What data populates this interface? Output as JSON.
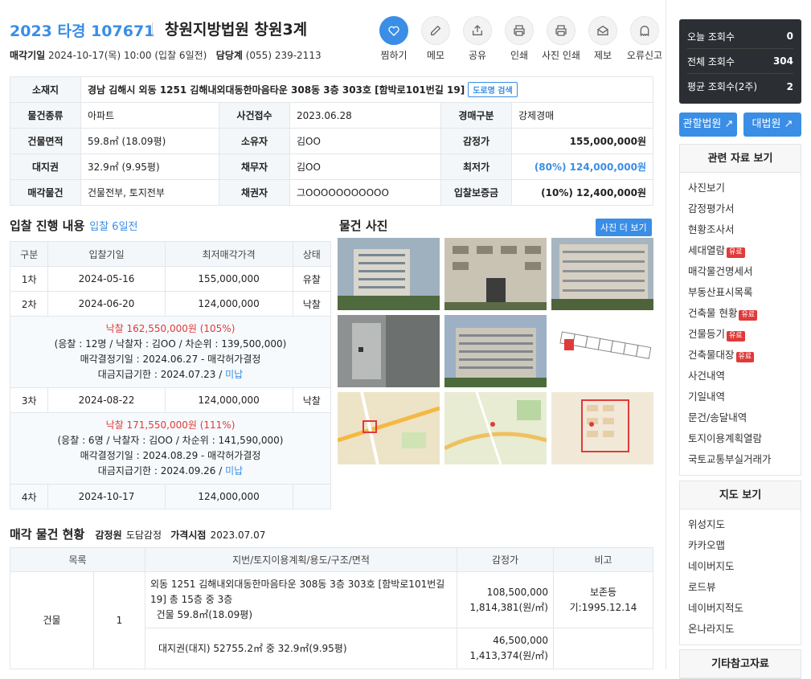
{
  "header": {
    "case_no": "2023 타경 107671",
    "court": "창원지방법원 창원3계",
    "date_label": "매각기일",
    "date_value": "2024-10-17(목) 10:00 (입찰 6일전)",
    "dept_label": "담당계",
    "dept_value": "(055) 239-2113"
  },
  "actions": [
    {
      "label": "찜하기",
      "icon": "heart-icon"
    },
    {
      "label": "메모",
      "icon": "pencil-icon"
    },
    {
      "label": "공유",
      "icon": "share-icon"
    },
    {
      "label": "인쇄",
      "icon": "printer-icon"
    },
    {
      "label": "사진 인쇄",
      "icon": "printer-icon"
    },
    {
      "label": "제보",
      "icon": "envelope-icon"
    },
    {
      "label": "오류신고",
      "icon": "ghost-icon"
    }
  ],
  "info": {
    "addr_label": "소재지",
    "addr": "경남 김해시 외동 1251 김해내외대동한마음타운 308동 3층 303호 [함박로101번길 19]",
    "road_btn": "도로명 검색",
    "type_label": "물건종류",
    "type": "아파트",
    "filed_label": "사건접수",
    "filed": "2023.06.28",
    "kind_label": "경매구분",
    "kind": "강제경매",
    "area_label": "건물면적",
    "area": "59.8㎡ (18.09평)",
    "owner_label": "소유자",
    "owner": "김OO",
    "appr_label": "감정가",
    "appr": "155,000,000원",
    "land_label": "대지권",
    "land": "32.9㎡ (9.95평)",
    "debtor_label": "채무자",
    "debtor": "김OO",
    "min_label": "최저가",
    "min": "(80%) 124,000,000원",
    "sale_label": "매각물건",
    "sale": "건물전부, 토지전부",
    "creditor_label": "채권자",
    "creditor": "그OOOOOOOOOOO",
    "dep_label": "입찰보증금",
    "dep": "(10%) 12,400,000원"
  },
  "bid": {
    "title": "입찰 진행 내용",
    "sub": "입찰 6일전",
    "headers": [
      "구분",
      "입찰기일",
      "최저매각가격",
      "상태"
    ],
    "r1": [
      "1차",
      "2024-05-16",
      "155,000,000",
      "유찰"
    ],
    "r2": [
      "2차",
      "2024-06-20",
      "124,000,000",
      "낙찰"
    ],
    "d2a": "낙찰 162,550,000원",
    "d2b": "(105%)",
    "d2c": "(응찰 : 12명 / 낙찰자 : 김OO / 차순위 : 139,500,000)",
    "d2d": "매각결정기일 : 2024.06.27 - 매각허가결정",
    "d2e": "대금지급기한 : 2024.07.23 /",
    "d2f": "미납",
    "r3": [
      "3차",
      "2024-08-22",
      "124,000,000",
      "낙찰"
    ],
    "d3a": "낙찰 171,550,000원",
    "d3b": "(111%)",
    "d3c": "(응찰 : 6명 / 낙찰자 : 김OO / 차순위 : 141,590,000)",
    "d3d": "매각결정기일 : 2024.08.29 - 매각허가결정",
    "d3e": "대금지급기한 : 2024.09.26 /",
    "d3f": "미납",
    "r4": [
      "4차",
      "2024-10-17",
      "124,000,000",
      ""
    ]
  },
  "photos": {
    "title": "물건 사진",
    "more": "사진 더 보기"
  },
  "sale": {
    "title": "매각 물건 현황",
    "appr_org_label": "감정원",
    "appr_org": "도담감정",
    "price_date_label": "가격시점",
    "price_date": "2023.07.07",
    "headers": [
      "목록",
      "지번/토지이용계획/용도/구조/면적",
      "감정가",
      "비고"
    ],
    "cat": "건물",
    "no": "1",
    "desc1": "외동 1251 김해내외대동한마음타운 308동 3층 303호 [함박로101번길 19] 총 15층 중 3층",
    "desc1b": "건물 59.8㎡(18.09평)",
    "val1": "108,500,000",
    "unit1": "1,814,381(원/㎡)",
    "note1": "보존등기:1995.12.14",
    "desc2": "대지권(대지) 52755.2㎡ 중 32.9㎡(9.95평)",
    "val2": "46,500,000",
    "unit2": "1,413,374(원/㎡)"
  },
  "stats": {
    "today_label": "오늘 조회수",
    "today": "0",
    "total_label": "전체 조회수",
    "total": "304",
    "avg_label": "평균 조회수(2주)",
    "avg": "2"
  },
  "side_btns": {
    "court": "관할법원",
    "supreme": "대법원"
  },
  "related": {
    "title": "관련 자료 보기",
    "items": [
      "사진보기",
      "감정평가서",
      "현황조사서",
      "세대열람",
      "매각물건명세서",
      "부동산표시목록",
      "건축물 현황",
      "건물등기",
      "건축물대장",
      "사건내역",
      "기일내역",
      "문건/송달내역",
      "토지이용계획열람",
      "국토교통부실거래가"
    ],
    "pay": "유료"
  },
  "maps": {
    "title": "지도 보기",
    "items": [
      "위성지도",
      "카카오맵",
      "네이버지도",
      "로드뷰",
      "네이버지적도",
      "온나라지도"
    ]
  },
  "etc": {
    "title": "기타참고자료"
  }
}
